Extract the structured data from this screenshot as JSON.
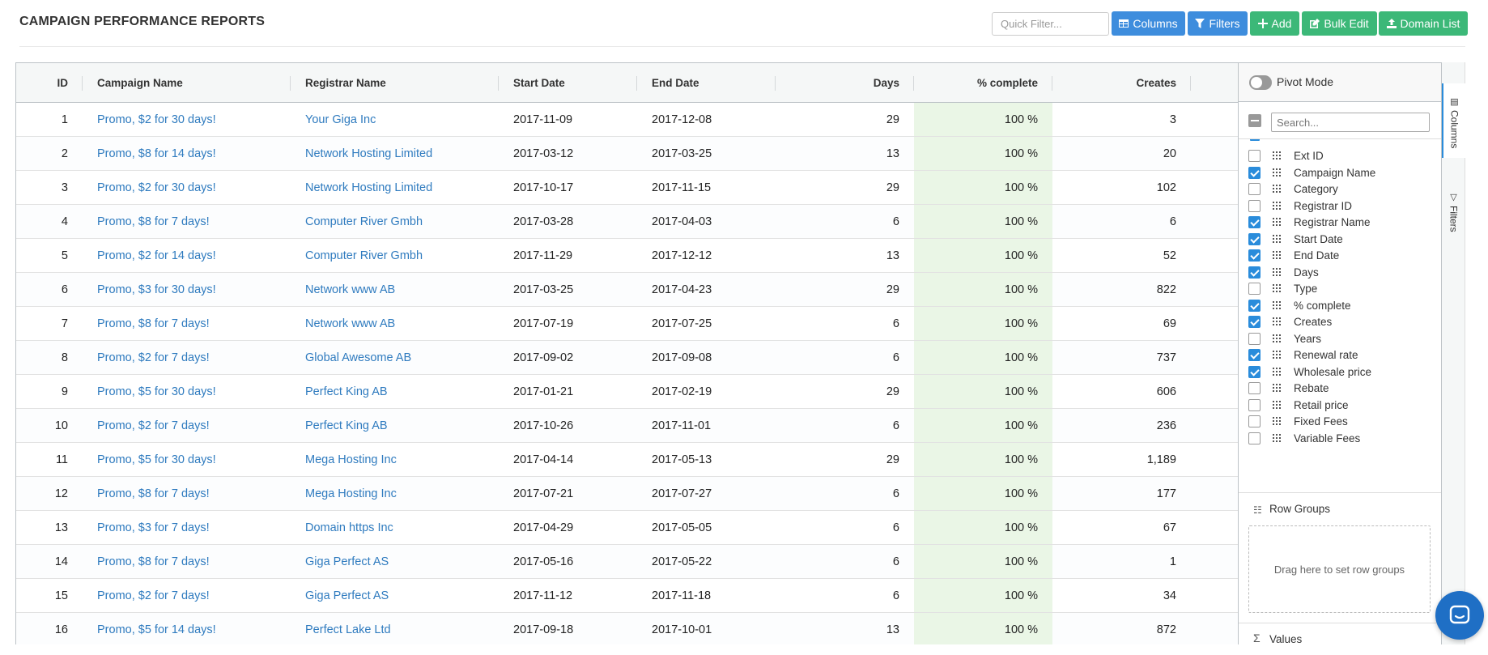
{
  "page": {
    "title": "CAMPAIGN PERFORMANCE REPORTS"
  },
  "toolbar": {
    "quick_filter_placeholder": "Quick Filter...",
    "columns_label": "Columns",
    "filters_label": "Filters",
    "add_label": "Add",
    "bulk_edit_label": "Bulk Edit",
    "domain_list_label": "Domain List",
    "colors": {
      "blue": "#3e8ddd",
      "green": "#3cb878"
    }
  },
  "table": {
    "headers": {
      "id": "ID",
      "campaign": "Campaign Name",
      "registrar": "Registrar Name",
      "start": "Start Date",
      "end": "End Date",
      "days": "Days",
      "pct": "% complete",
      "creates": "Creates"
    },
    "rows": [
      {
        "id": "1",
        "campaign": "Promo, $2 for 30 days!",
        "registrar": "Your Giga Inc",
        "start": "2017-11-09",
        "end": "2017-12-08",
        "days": "29",
        "pct": "100 %",
        "creates": "3"
      },
      {
        "id": "2",
        "campaign": "Promo, $8 for 14 days!",
        "registrar": "Network Hosting Limited",
        "start": "2017-03-12",
        "end": "2017-03-25",
        "days": "13",
        "pct": "100 %",
        "creates": "20"
      },
      {
        "id": "3",
        "campaign": "Promo, $2 for 30 days!",
        "registrar": "Network Hosting Limited",
        "start": "2017-10-17",
        "end": "2017-11-15",
        "days": "29",
        "pct": "100 %",
        "creates": "102"
      },
      {
        "id": "4",
        "campaign": "Promo, $8 for 7 days!",
        "registrar": "Computer River Gmbh",
        "start": "2017-03-28",
        "end": "2017-04-03",
        "days": "6",
        "pct": "100 %",
        "creates": "6"
      },
      {
        "id": "5",
        "campaign": "Promo, $2 for 14 days!",
        "registrar": "Computer River Gmbh",
        "start": "2017-11-29",
        "end": "2017-12-12",
        "days": "13",
        "pct": "100 %",
        "creates": "52"
      },
      {
        "id": "6",
        "campaign": "Promo, $3 for 30 days!",
        "registrar": "Network www AB",
        "start": "2017-03-25",
        "end": "2017-04-23",
        "days": "29",
        "pct": "100 %",
        "creates": "822"
      },
      {
        "id": "7",
        "campaign": "Promo, $8 for 7 days!",
        "registrar": "Network www AB",
        "start": "2017-07-19",
        "end": "2017-07-25",
        "days": "6",
        "pct": "100 %",
        "creates": "69"
      },
      {
        "id": "8",
        "campaign": "Promo, $2 for 7 days!",
        "registrar": "Global Awesome AB",
        "start": "2017-09-02",
        "end": "2017-09-08",
        "days": "6",
        "pct": "100 %",
        "creates": "737"
      },
      {
        "id": "9",
        "campaign": "Promo, $5 for 30 days!",
        "registrar": "Perfect King AB",
        "start": "2017-01-21",
        "end": "2017-02-19",
        "days": "29",
        "pct": "100 %",
        "creates": "606"
      },
      {
        "id": "10",
        "campaign": "Promo, $2 for 7 days!",
        "registrar": "Perfect King AB",
        "start": "2017-10-26",
        "end": "2017-11-01",
        "days": "6",
        "pct": "100 %",
        "creates": "236"
      },
      {
        "id": "11",
        "campaign": "Promo, $5 for 30 days!",
        "registrar": "Mega Hosting Inc",
        "start": "2017-04-14",
        "end": "2017-05-13",
        "days": "29",
        "pct": "100 %",
        "creates": "1,189"
      },
      {
        "id": "12",
        "campaign": "Promo, $8 for 7 days!",
        "registrar": "Mega Hosting Inc",
        "start": "2017-07-21",
        "end": "2017-07-27",
        "days": "6",
        "pct": "100 %",
        "creates": "177"
      },
      {
        "id": "13",
        "campaign": "Promo, $3 for 7 days!",
        "registrar": "Domain https Inc",
        "start": "2017-04-29",
        "end": "2017-05-05",
        "days": "6",
        "pct": "100 %",
        "creates": "67"
      },
      {
        "id": "14",
        "campaign": "Promo, $8 for 7 days!",
        "registrar": "Giga Perfect AS",
        "start": "2017-05-16",
        "end": "2017-05-22",
        "days": "6",
        "pct": "100 %",
        "creates": "1"
      },
      {
        "id": "15",
        "campaign": "Promo, $2 for 7 days!",
        "registrar": "Giga Perfect AS",
        "start": "2017-11-12",
        "end": "2017-11-18",
        "days": "6",
        "pct": "100 %",
        "creates": "34"
      },
      {
        "id": "16",
        "campaign": "Promo, $5 for 14 days!",
        "registrar": "Perfect Lake Ltd",
        "start": "2017-09-18",
        "end": "2017-10-01",
        "days": "13",
        "pct": "100 %",
        "creates": "872"
      }
    ]
  },
  "side_panel": {
    "pivot_mode_label": "Pivot Mode",
    "pivot_mode_on": false,
    "search_placeholder": "Search...",
    "columns": [
      {
        "label": "Ext ID",
        "checked": false
      },
      {
        "label": "Campaign Name",
        "checked": true
      },
      {
        "label": "Category",
        "checked": false
      },
      {
        "label": "Registrar ID",
        "checked": false
      },
      {
        "label": "Registrar Name",
        "checked": true
      },
      {
        "label": "Start Date",
        "checked": true
      },
      {
        "label": "End Date",
        "checked": true
      },
      {
        "label": "Days",
        "checked": true
      },
      {
        "label": "Type",
        "checked": false
      },
      {
        "label": "% complete",
        "checked": true
      },
      {
        "label": "Creates",
        "checked": true
      },
      {
        "label": "Years",
        "checked": false
      },
      {
        "label": "Renewal rate",
        "checked": true
      },
      {
        "label": "Wholesale price",
        "checked": true
      },
      {
        "label": "Rebate",
        "checked": false
      },
      {
        "label": "Retail price",
        "checked": false
      },
      {
        "label": "Fixed Fees",
        "checked": false
      },
      {
        "label": "Variable Fees",
        "checked": false
      }
    ],
    "row_groups_label": "Row Groups",
    "row_groups_drop_hint": "Drag here to set row groups",
    "values_label": "Values"
  },
  "side_tabs": {
    "columns": "Columns",
    "filters": "Filters"
  },
  "icons": {
    "columns_button": "table-icon",
    "filters_button": "filter-icon",
    "add_button": "plus-icon",
    "bulk_edit_button": "edit-icon",
    "domain_list_button": "upload-icon",
    "row_groups": "list-icon",
    "values": "sigma-icon",
    "chat": "chat-icon"
  }
}
